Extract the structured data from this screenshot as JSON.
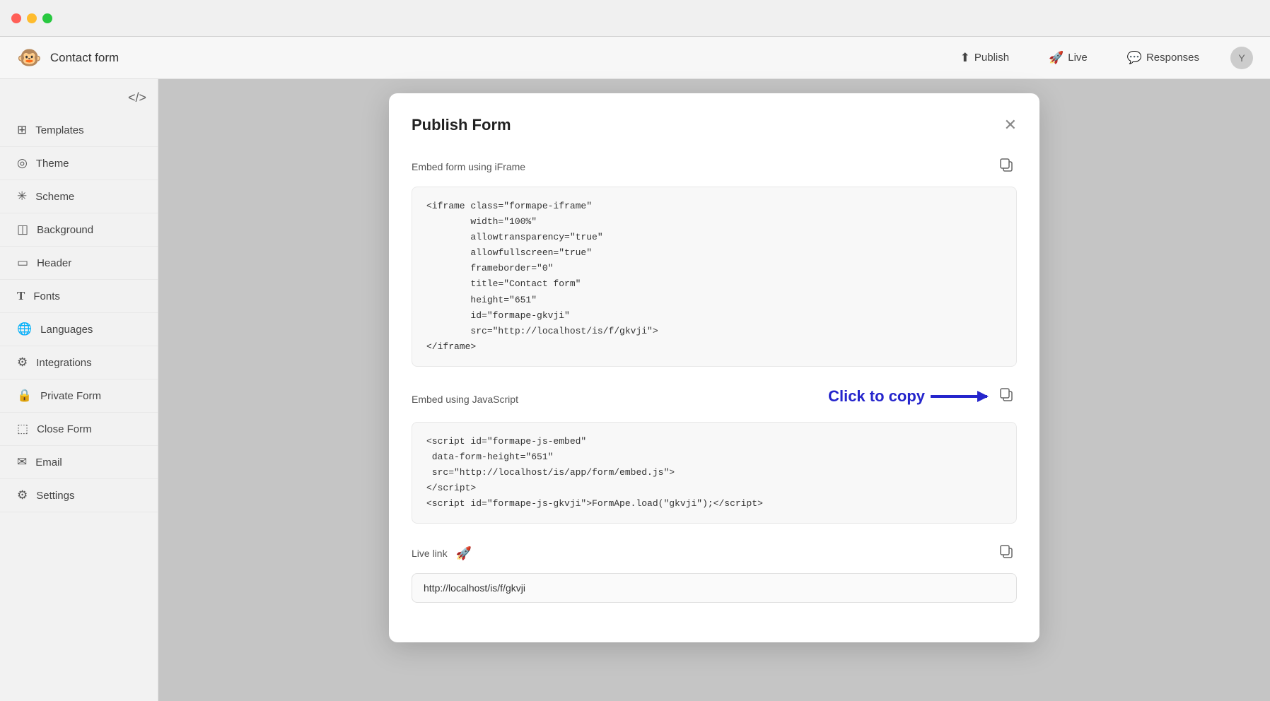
{
  "titlebar": {
    "traffic_lights": [
      "red",
      "yellow",
      "green"
    ]
  },
  "app_header": {
    "logo": "🐵",
    "title": "Contact form",
    "publish_label": "Publish",
    "live_label": "Live",
    "responses_label": "Responses",
    "user_initial": "Y"
  },
  "sidebar": {
    "code_icon": "</>",
    "items": [
      {
        "id": "templates",
        "icon": "⊞",
        "label": "Templates"
      },
      {
        "id": "theme",
        "icon": "◎",
        "label": "Theme"
      },
      {
        "id": "scheme",
        "icon": "✳",
        "label": "Scheme"
      },
      {
        "id": "background",
        "icon": "◫",
        "label": "Background"
      },
      {
        "id": "header",
        "icon": "▭",
        "label": "Header"
      },
      {
        "id": "fonts",
        "icon": "T",
        "label": "Fonts"
      },
      {
        "id": "languages",
        "icon": "🌐",
        "label": "Languages"
      },
      {
        "id": "integrations",
        "icon": "⚙",
        "label": "Integrations"
      },
      {
        "id": "private-form",
        "icon": "🔒",
        "label": "Private Form"
      },
      {
        "id": "close-form",
        "icon": "⬚",
        "label": "Close Form"
      },
      {
        "id": "email",
        "icon": "✉",
        "label": "Email"
      },
      {
        "id": "settings",
        "icon": "⚙",
        "label": "Settings"
      }
    ]
  },
  "modal": {
    "title": "Publish Form",
    "iframe_section": {
      "label": "Embed form using iFrame",
      "code": "<iframe class=\"formape-iframe\"\n        width=\"100%\"\n        allowtransparency=\"true\"\n        allowfullscreen=\"true\"\n        frameborder=\"0\"\n        title=\"Contact form\"\n        height=\"651\"\n        id=\"formape-gkvji\"\n        src=\"http://localhost/is/f/gkvji\">\n</iframe>"
    },
    "js_section": {
      "label": "Embed using JavaScript",
      "click_to_copy": "Click to copy",
      "code": "<script id=\"formape-js-embed\"\n data-form-height=\"651\"\n src=\"http://localhost/is/app/form/embed.js\">\n</script>\n<script id=\"formape-js-gkvji\">FormApe.load(\"gkvji\");</script>"
    },
    "live_link_section": {
      "label": "Live link",
      "value": "http://localhost/is/f/gkvji"
    }
  }
}
